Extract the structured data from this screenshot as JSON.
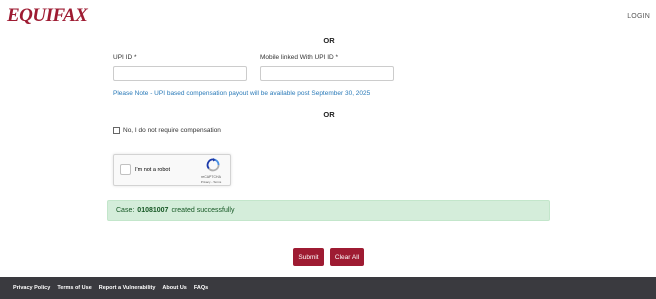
{
  "header": {
    "logo": "EQUIFAX",
    "login": "LOGIN"
  },
  "form": {
    "or_top": "OR",
    "upi_id_label": "UPI ID *",
    "upi_id_value": "",
    "mobile_label": "Mobile linked With UPI ID *",
    "mobile_value": "",
    "note": "Please Note - UPI based compensation payout will be available post September 30, 2025",
    "or_middle": "OR",
    "no_compensation_label": "No, I do not require compensation"
  },
  "captcha": {
    "label": "I'm not a robot",
    "brand": "reCAPTCHA",
    "links": "Privacy - Terms"
  },
  "alert": {
    "prefix": "Case:",
    "case_number": "01081007",
    "suffix": "created successfully"
  },
  "buttons": {
    "submit": "Submit",
    "clear_all": "Clear All"
  },
  "footer": {
    "links": [
      "Privacy Policy",
      "Terms of Use",
      "Report a Vulnerability",
      "About Us",
      "FAQs"
    ]
  },
  "colors": {
    "brand": "#9e1b32",
    "note_blue": "#2a7ab8",
    "success_bg": "#d4edda",
    "footer_bg": "#3a3a3f"
  }
}
